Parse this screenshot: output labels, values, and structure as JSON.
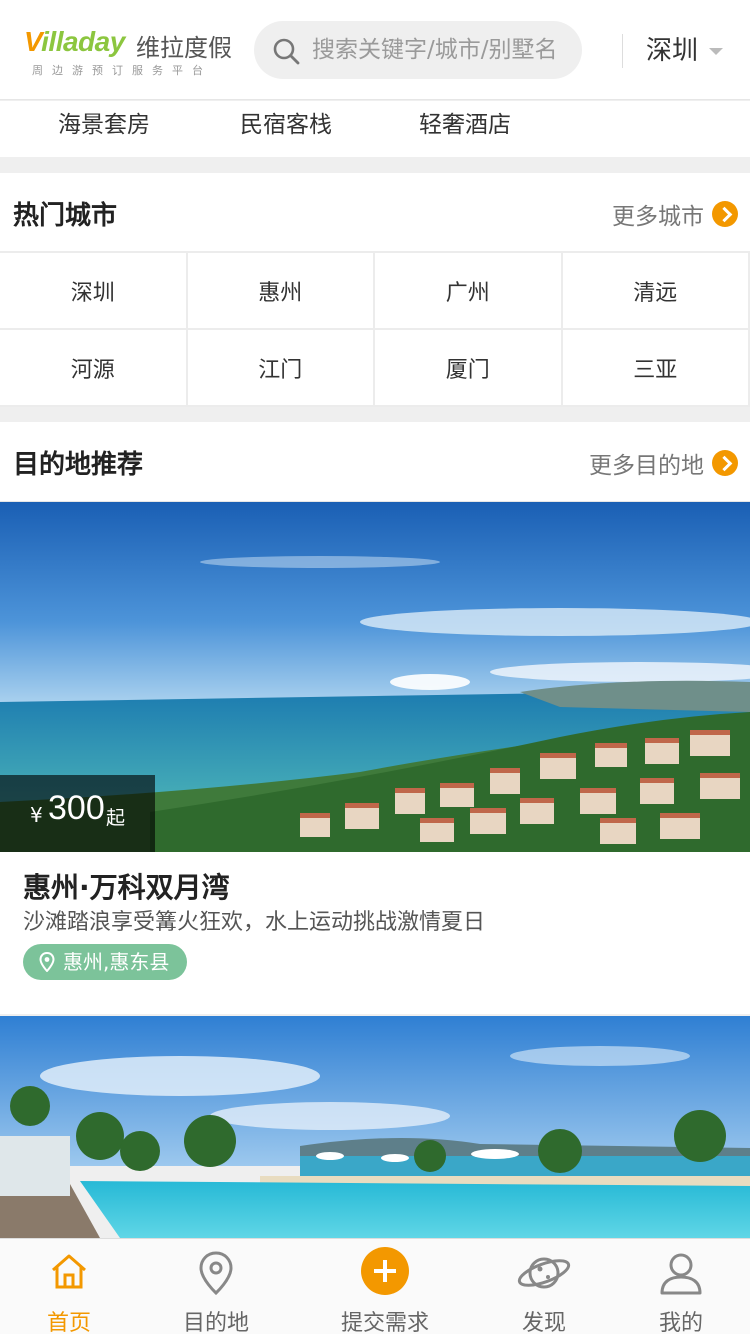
{
  "header": {
    "logo_en_v": "V",
    "logo_en_rest": "illaday",
    "logo_cn": "维拉度假",
    "logo_slogan": "周边游预订服务平台",
    "search_placeholder": "搜索关键字/城市/别墅名",
    "city": "深圳"
  },
  "categories": [
    "海景套房",
    "民宿客栈",
    "轻奢酒店"
  ],
  "hot_cities": {
    "title": "热门城市",
    "more": "更多城市",
    "cities": [
      "深圳",
      "惠州",
      "广州",
      "清远",
      "河源",
      "江门",
      "厦门",
      "三亚"
    ]
  },
  "destinations": {
    "title": "目的地推荐",
    "more": "更多目的地",
    "items": [
      {
        "price_currency": "¥",
        "price": "300",
        "price_suffix": "起",
        "title": "惠州·万科双月湾",
        "desc": "沙滩踏浪享受篝火狂欢，水上运动挑战激情夏日",
        "location": "惠州,惠东县"
      }
    ]
  },
  "tabbar": [
    "首页",
    "目的地",
    "提交需求",
    "发现",
    "我的"
  ],
  "colors": {
    "accent": "#f39800",
    "green": "#8cc63f",
    "badge": "#7cc39a"
  }
}
